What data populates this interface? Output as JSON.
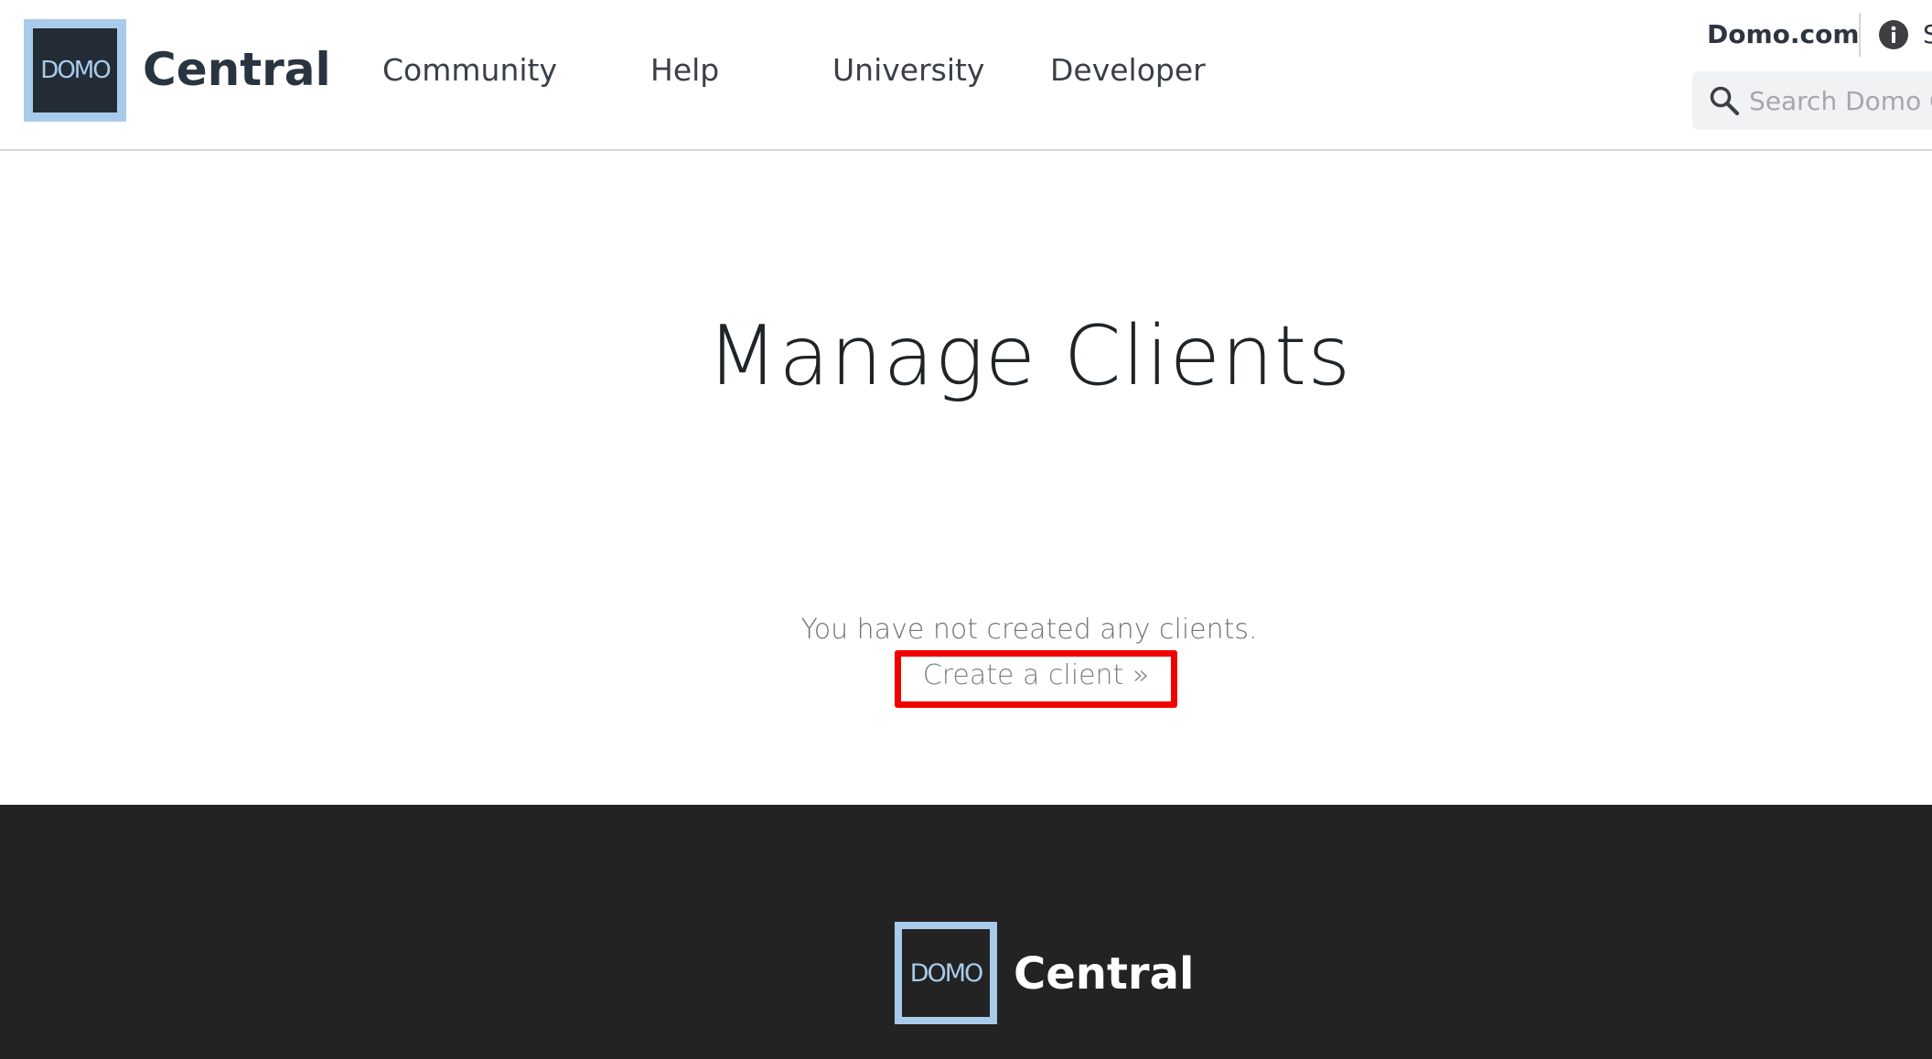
{
  "header": {
    "logo_text": "DOMO",
    "brand": "Central",
    "nav": [
      {
        "label": "Community"
      },
      {
        "label": "Help"
      },
      {
        "label": "University"
      },
      {
        "label": "Developer"
      }
    ],
    "domo_link": "Domo.com",
    "info_trailing_text": "S",
    "search": {
      "placeholder": "Search Domo Central",
      "value": ""
    }
  },
  "main": {
    "title": "Manage Clients",
    "empty_message": "You have not created any clients.",
    "create_link": "Create a client »"
  },
  "footer": {
    "logo_text": "DOMO",
    "brand": "Central"
  },
  "colors": {
    "logo_frame": "#a8cbeb",
    "logo_inner": "#232b35",
    "footer_bg": "#232323",
    "highlight_box": "#f10000"
  },
  "icons": {
    "info": "info-icon",
    "search": "search-icon"
  }
}
